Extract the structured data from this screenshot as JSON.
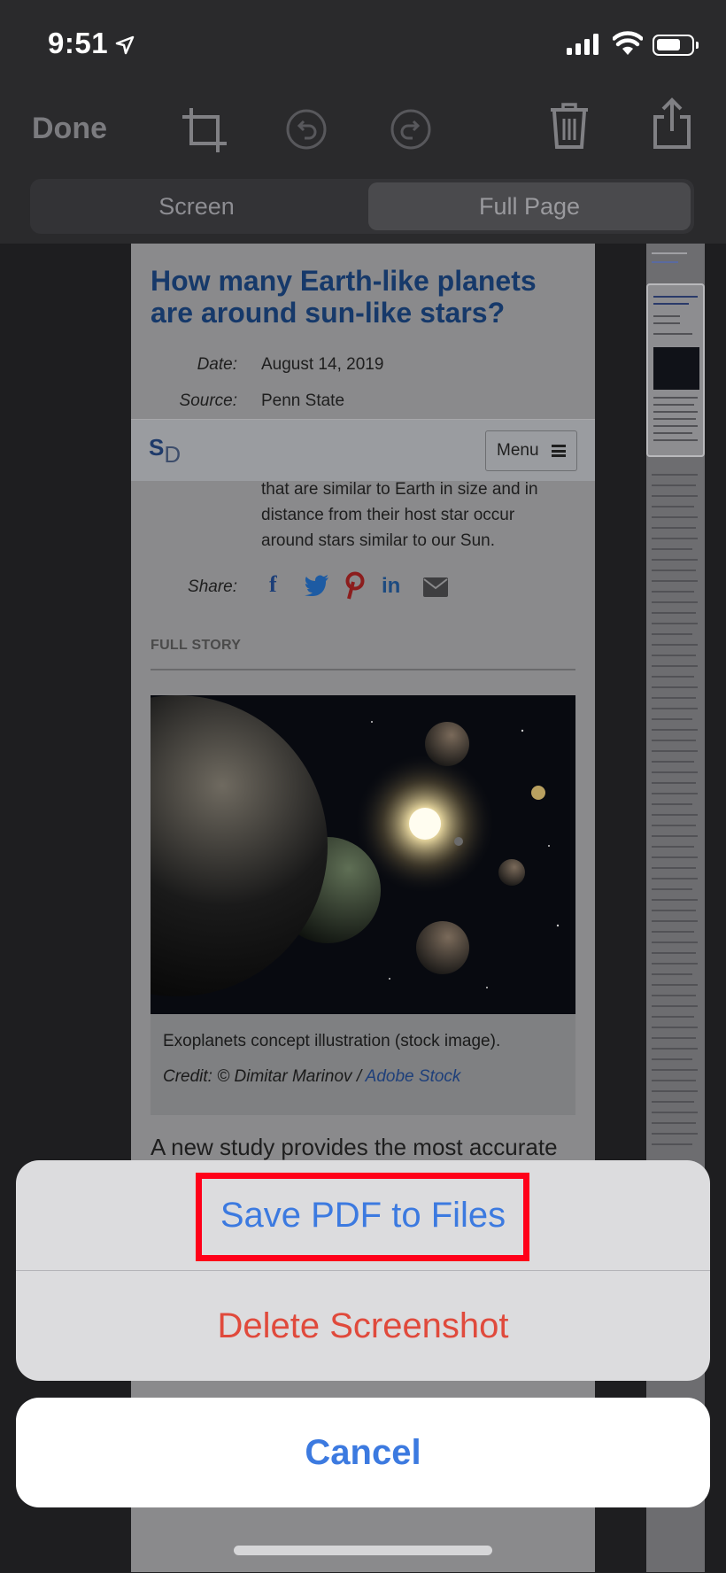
{
  "status_bar": {
    "time": "9:51"
  },
  "toolbar": {
    "done_label": "Done",
    "icons": [
      "crop-icon",
      "undo-icon",
      "redo-icon",
      "trash-icon",
      "share-icon"
    ]
  },
  "segment": {
    "screen_label": "Screen",
    "full_page_label": "Full Page",
    "selected": "Full Page"
  },
  "article": {
    "title": "How many Earth-like planets are around sun-like stars?",
    "date_label": "Date:",
    "date": "August 14, 2019",
    "source_label": "Source:",
    "source": "Penn State",
    "logo_s": "S",
    "logo_d": "D",
    "menu_label": "Menu",
    "summary": "that are similar to Earth in size and in distance from their host star occur around stars similar to our Sun.",
    "share_label": "Share:",
    "share_icons": {
      "facebook": "f",
      "linkedin": "in"
    },
    "full_story_label": "FULL STORY",
    "caption": "Exoplanets concept illustration (stock image).",
    "credit_prefix": "Credit: © Dimitar Marinov / ",
    "credit_link": "Adobe Stock",
    "body_line1": "A new study provides the most accurate es-"
  },
  "action_sheet": {
    "save_label": "Save PDF to Files",
    "delete_label": "Delete Screenshot",
    "cancel_label": "Cancel"
  },
  "colors": {
    "accent_blue": "#3c7ae0",
    "destructive_red": "#e04a3c",
    "highlight_red": "#ff0019"
  }
}
